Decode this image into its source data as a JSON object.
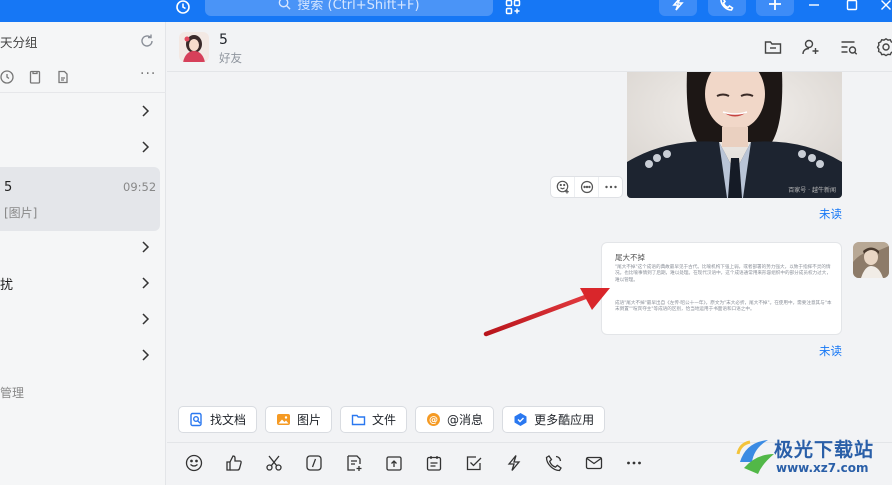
{
  "topbar": {
    "search_placeholder": "搜索 (Ctrl+Shift+F)",
    "icons": [
      "history-icon",
      "search-icon",
      "apps-icon",
      "lightning-icon",
      "phone-icon",
      "plus-icon",
      "minimize-icon",
      "maximize-icon",
      "close-icon"
    ]
  },
  "sidebar": {
    "group_label": "天分组",
    "rows": [
      {
        "label": ""
      },
      {
        "label": ""
      },
      {
        "label": ""
      },
      {
        "label": "扰"
      },
      {
        "label": ""
      },
      {
        "label": ""
      }
    ],
    "active": {
      "name": "5",
      "time": "09:52",
      "preview": "[图片]"
    },
    "manage_label": "管理"
  },
  "chat": {
    "name": "5",
    "subtitle": "好友",
    "unread_label_1": "未读",
    "unread_label_2": "未读",
    "photo_caption": "百家号 · 越牛新闻",
    "doc": {
      "title": "尾大不掉",
      "para1": "\"尾大不掉\"这个成语的典故最早见于古代。比喻机构下强上弱，或者部署的势力强大，以致于指挥不灵的情况。也比喻事情到了后期，难以处理。在现代汉语中，这个成语通常用来形容组织中的部分成员权力过大，难以管理。",
      "para2": "成语\"尾大不掉\"最早出自《左传·昭公十一年》，原文为\"末大必折，尾大不掉\"。在使用中，需要注意其与\"本末倒置\"\"喧宾夺主\"等成语的区别，恰当地运用于书面语和口语之中。"
    }
  },
  "quick_bar": [
    {
      "label": "找文档",
      "icon": "find-doc-icon"
    },
    {
      "label": "图片",
      "icon": "image-icon"
    },
    {
      "label": "文件",
      "icon": "folder-icon"
    },
    {
      "label": "@消息",
      "icon": "at-icon"
    },
    {
      "label": "更多酷应用",
      "icon": "cool-apps-icon"
    }
  ],
  "watermark": {
    "line1": "极光下载站",
    "line2": "www.xz7.com"
  },
  "colors": {
    "accent": "#1677f5",
    "arrow": "#d9262b",
    "unread": "#1677f5"
  }
}
